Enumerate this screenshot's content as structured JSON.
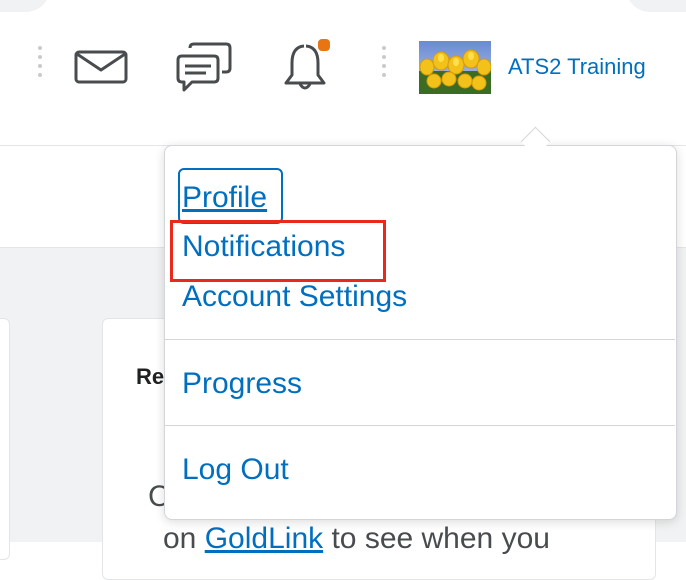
{
  "header": {
    "user_name": "ATS2 Training",
    "icons": {
      "mail": "mail-icon",
      "chat": "chat-icon",
      "bell": "bell-icon"
    },
    "notification_dot_color": "#e87511",
    "link_color": "#006fbf"
  },
  "dropdown": {
    "items": [
      {
        "label": "Profile",
        "state": "focused"
      },
      {
        "label": "Notifications",
        "state": "highlighted"
      },
      {
        "label": "Account Settings"
      },
      {
        "label": "Progress"
      },
      {
        "label": "Log Out"
      }
    ]
  },
  "card": {
    "heading": "Re",
    "line1_prefix": "C",
    "line2_prefix": "on ",
    "line2_link": "GoldLink",
    "line2_suffix": " to see when you"
  }
}
